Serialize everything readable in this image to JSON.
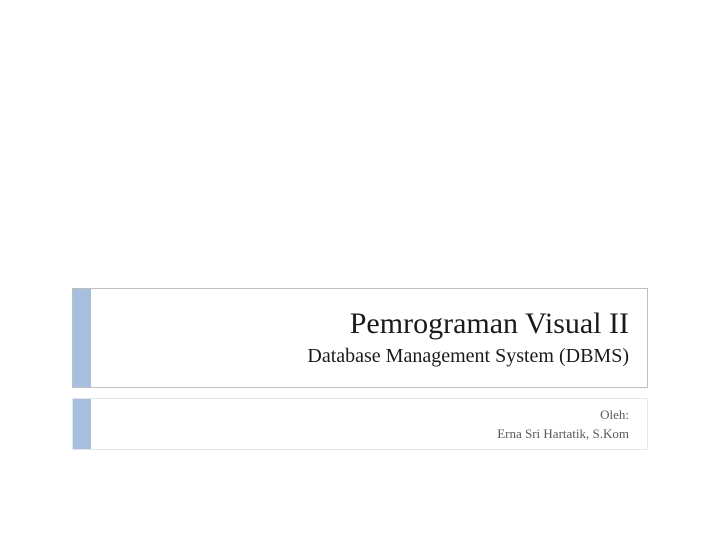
{
  "slide": {
    "title": "Pemrograman Visual II",
    "subtitle": "Database Management System (DBMS)",
    "author_label": "Oleh:",
    "author_name": "Erna Sri Hartatik, S.Kom"
  }
}
